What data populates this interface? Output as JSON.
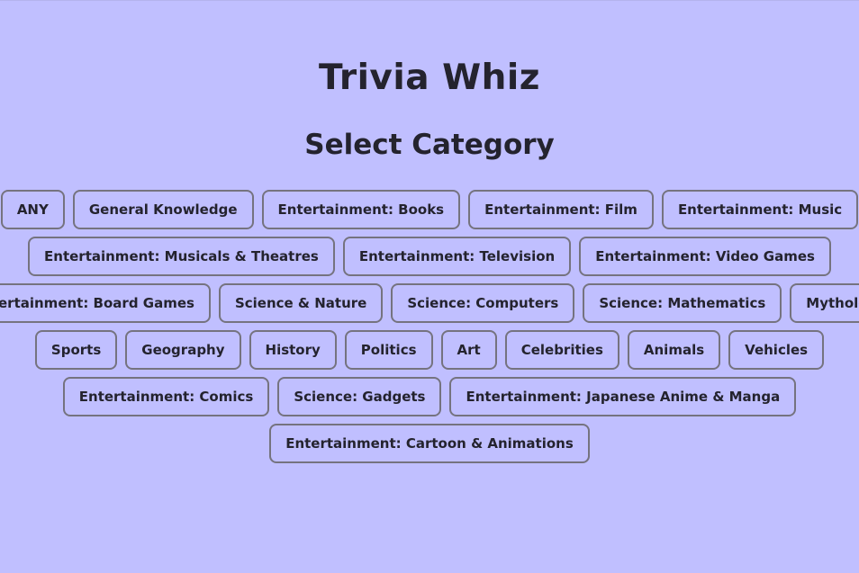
{
  "app": {
    "title": "Trivia Whiz",
    "subtitle": "Select Category"
  },
  "categories": [
    "ANY",
    "General Knowledge",
    "Entertainment: Books",
    "Entertainment: Film",
    "Entertainment: Music",
    "Entertainment: Musicals & Theatres",
    "Entertainment: Television",
    "Entertainment: Video Games",
    "Entertainment: Board Games",
    "Science & Nature",
    "Science: Computers",
    "Science: Mathematics",
    "Mythology",
    "Sports",
    "Geography",
    "History",
    "Politics",
    "Art",
    "Celebrities",
    "Animals",
    "Vehicles",
    "Entertainment: Comics",
    "Science: Gadgets",
    "Entertainment: Japanese Anime & Manga",
    "Entertainment: Cartoon & Animations"
  ]
}
